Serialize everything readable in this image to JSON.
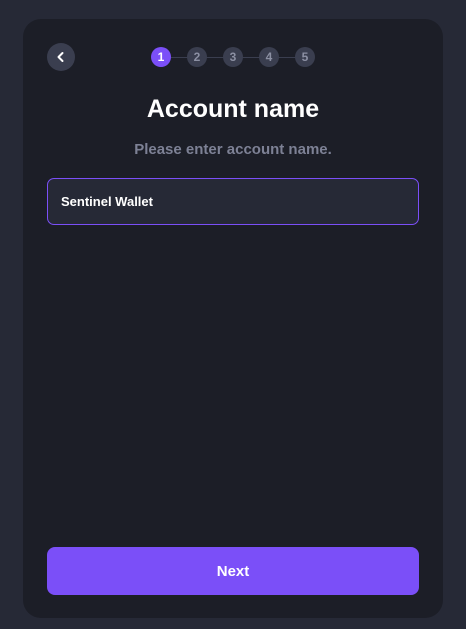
{
  "header": {
    "back_icon": "chevron-left-icon"
  },
  "stepper": {
    "current": 1,
    "steps": [
      "1",
      "2",
      "3",
      "4",
      "5"
    ]
  },
  "main": {
    "title": "Account name",
    "subtitle": "Please enter account name.",
    "account_name_value": "Sentinel Wallet",
    "account_name_placeholder": ""
  },
  "footer": {
    "next_label": "Next"
  },
  "colors": {
    "accent": "#7b4ff8",
    "background": "#262936",
    "card": "#1c1e27"
  }
}
